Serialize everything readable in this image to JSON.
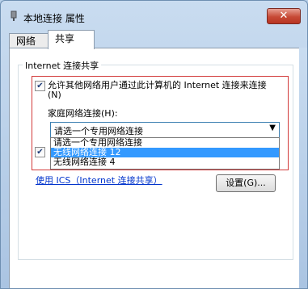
{
  "window": {
    "title": "本地连接 属性",
    "close_glyph": "✕",
    "icon": "network-adapter-icon"
  },
  "tabs": [
    {
      "label": "网络",
      "active": false
    },
    {
      "label": "共享",
      "active": true
    }
  ],
  "group": {
    "legend": "Internet 连接共享"
  },
  "allow_sharing": {
    "checked": true,
    "label": "允许其他网络用户通过此计算机的 Internet 连接来连接(N)"
  },
  "home_network": {
    "label": "家庭网络连接(H):",
    "selected_value": "请选一个专用网络连接",
    "options": [
      {
        "label": "请选一个专用网络连接",
        "highlighted": false
      },
      {
        "label": "无线网络连接 12",
        "highlighted": true
      },
      {
        "label": "无线网络连接 4",
        "highlighted": false
      }
    ]
  },
  "second_checkbox": {
    "checked": true
  },
  "ics_link": "使用 ICS（Internet 连接共享）",
  "settings_button": "设置(G)...",
  "colors": {
    "selection": "#3399ff",
    "highlight_border": "#d23a3a",
    "link": "#0033cc",
    "close_button": "#c74a36"
  }
}
